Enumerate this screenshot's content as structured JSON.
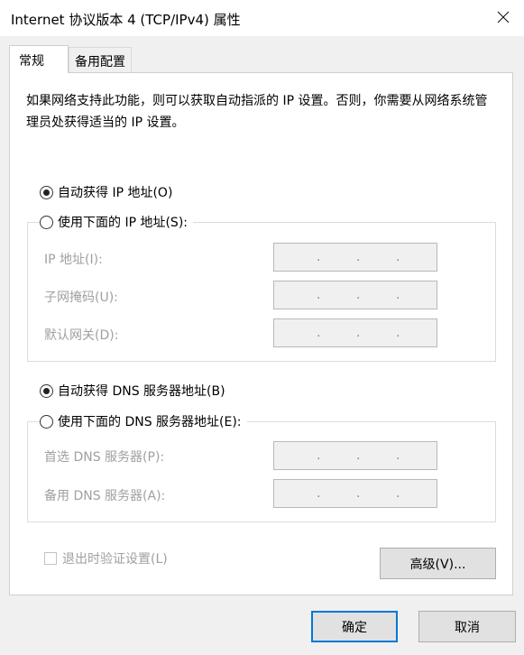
{
  "window": {
    "title": "Internet 协议版本 4 (TCP/IPv4) 属性"
  },
  "tabs": {
    "general": "常规",
    "alternate": "备用配置"
  },
  "description": "如果网络支持此功能，则可以获取自动指派的 IP 设置。否则，你需要从网络系统管理员处获得适当的 IP 设置。",
  "ip": {
    "auto_label": "自动获得 IP 地址(O)",
    "manual_label": "使用下面的 IP 地址(S):",
    "selected": "auto",
    "fields": {
      "address": "IP 地址(I):",
      "subnet": "子网掩码(U):",
      "gateway": "默认网关(D):"
    }
  },
  "dns": {
    "auto_label": "自动获得 DNS 服务器地址(B)",
    "manual_label": "使用下面的 DNS 服务器地址(E):",
    "selected": "auto",
    "fields": {
      "preferred": "首选 DNS 服务器(P):",
      "alternate": "备用 DNS 服务器(A):"
    }
  },
  "ip_separator": ".",
  "validate_label": "退出时验证设置(L)",
  "validate_checked": false,
  "buttons": {
    "advanced": "高级(V)...",
    "ok": "确定",
    "cancel": "取消"
  },
  "colors": {
    "accent": "#0078d7",
    "disabled_text": "#a0a0a0"
  },
  "icons": {
    "close": "close-icon"
  }
}
